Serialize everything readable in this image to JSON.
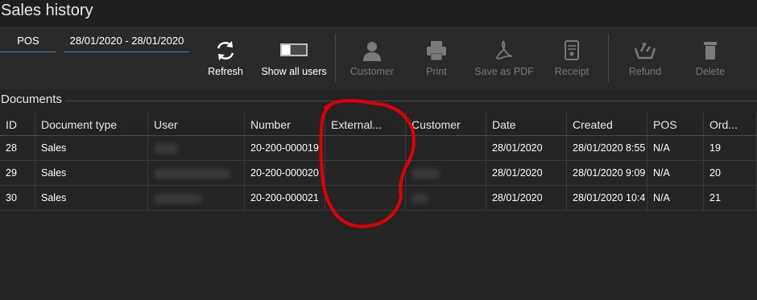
{
  "window": {
    "title": "Sales history"
  },
  "filters": {
    "pos": "POS",
    "date_range": "28/01/2020 - 28/01/2020"
  },
  "toolbar": {
    "refresh": "Refresh",
    "show_all_users": "Show all users",
    "customer": "Customer",
    "print": "Print",
    "save_as_pdf": "Save as PDF",
    "receipt": "Receipt",
    "refund": "Refund",
    "delete": "Delete"
  },
  "icons": [
    "refresh-icon",
    "toggle-switch-icon",
    "person-icon",
    "printer-icon",
    "pdf-icon",
    "receipt-icon",
    "refund-icon",
    "trash-icon"
  ],
  "colors": {
    "accent": "#3d87a7",
    "annotation": "#e0000a",
    "background": "#242424"
  },
  "documents": {
    "label": "Documents",
    "columns": [
      "ID",
      "Document type",
      "User",
      "Number",
      "External...",
      "Customer",
      "Date",
      "Created",
      "POS",
      "Ord..."
    ],
    "rows": [
      {
        "id": "28",
        "type": "Sales",
        "number": "20-200-000019",
        "date": "28/01/2020",
        "created": "28/01/2020 8:55",
        "pos": "N/A",
        "order": "19"
      },
      {
        "id": "29",
        "type": "Sales",
        "number": "20-200-000020",
        "date": "28/01/2020",
        "created": "28/01/2020 9:09",
        "pos": "N/A",
        "order": "20"
      },
      {
        "id": "30",
        "type": "Sales",
        "number": "20-200-000021",
        "date": "28/01/2020",
        "created": "28/01/2020 10:4",
        "pos": "N/A",
        "order": "21"
      }
    ]
  }
}
